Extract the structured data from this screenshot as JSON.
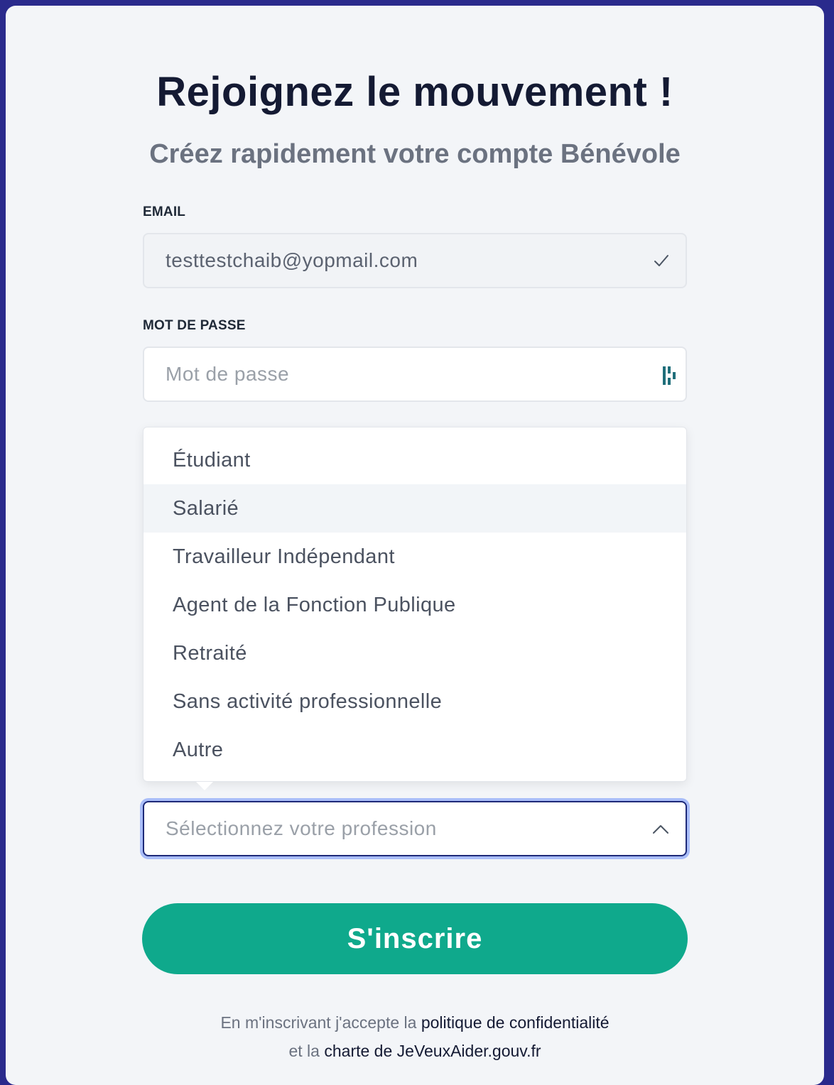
{
  "header": {
    "title": "Rejoignez le mouvement !",
    "subtitle": "Créez rapidement votre compte Bénévole"
  },
  "form": {
    "email": {
      "label": "EMAIL",
      "value": "testtestchaib@yopmail.com"
    },
    "password": {
      "label": "MOT DE PASSE",
      "placeholder": "Mot de passe"
    },
    "profession": {
      "placeholder": "Sélectionnez votre profession",
      "options": [
        "Étudiant",
        "Salarié",
        "Travailleur Indépendant",
        "Agent de la Fonction Publique",
        "Retraité",
        "Sans activité professionnelle",
        "Autre"
      ],
      "hovered_option": "Salarié"
    },
    "submit_label": "S'inscrire"
  },
  "legal": {
    "line1_prefix": "En m'inscrivant j'accepte la ",
    "line1_link": "politique de confidentialité",
    "line2_prefix": "et la ",
    "line2_link": "charte de JeVeuxAider.gouv.fr"
  },
  "colors": {
    "background": "#2a2a8c",
    "card": "#f3f5f8",
    "accent": "#0fa98c",
    "focus_ring": "#a9bdf8"
  },
  "icons": [
    "check-icon",
    "password-manager-icon",
    "chevron-up-icon"
  ]
}
